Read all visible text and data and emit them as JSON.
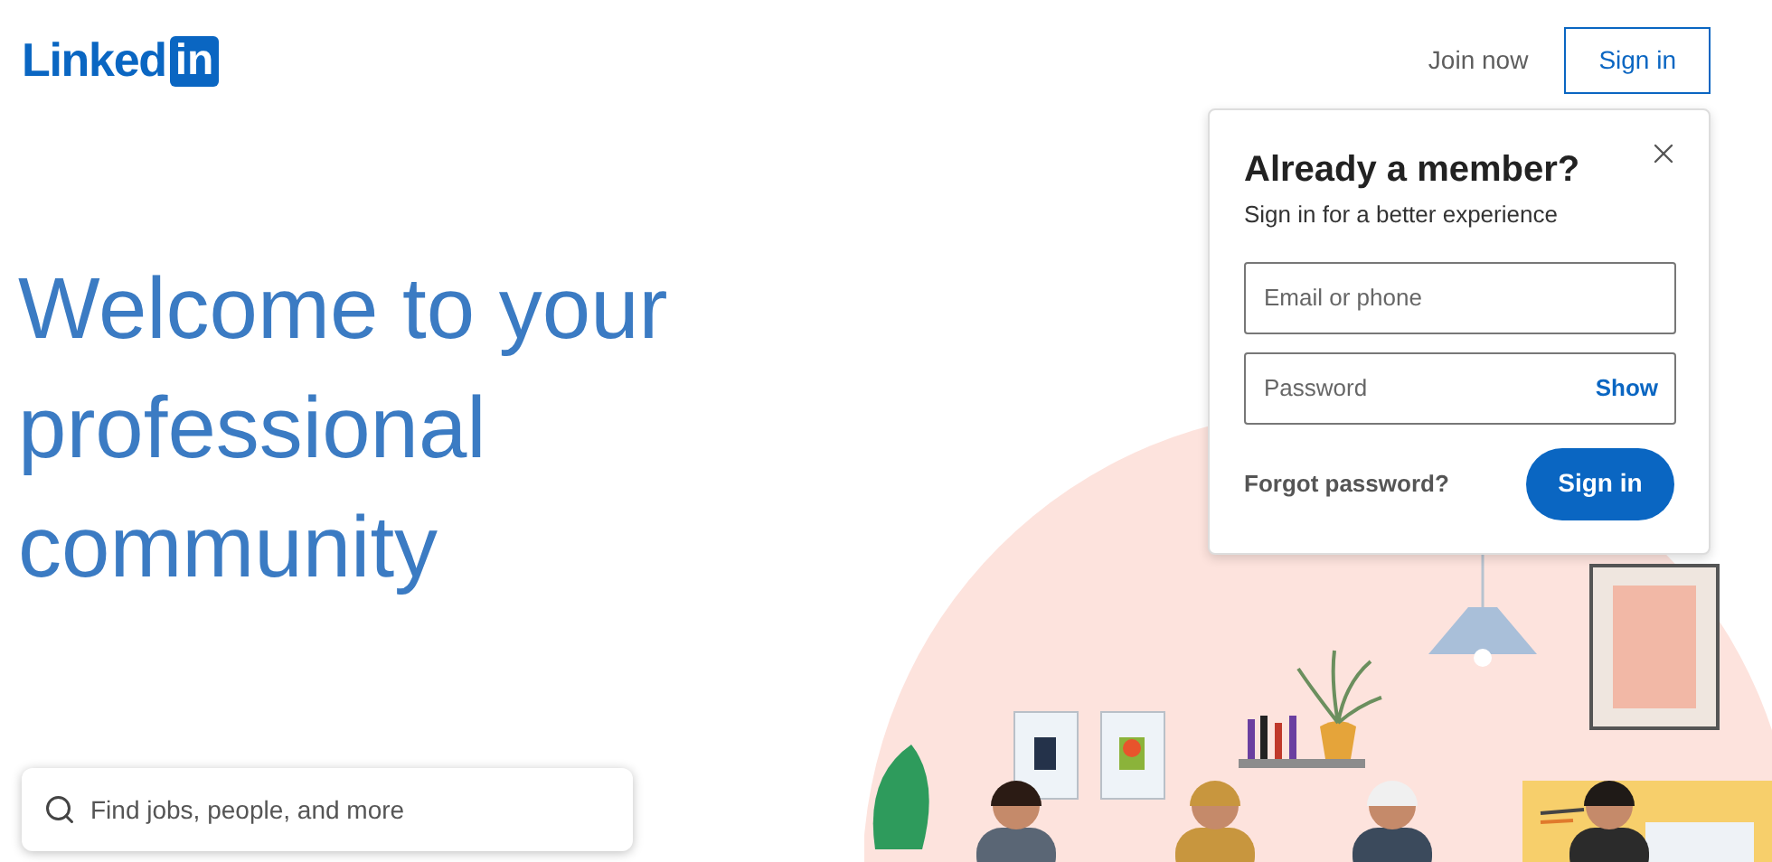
{
  "logo": {
    "text": "Linked",
    "badge": "in"
  },
  "nav": {
    "join": "Join now",
    "sign_in": "Sign in"
  },
  "hero": {
    "title": "Welcome to your professional community"
  },
  "search": {
    "placeholder": "Find jobs, people, and more"
  },
  "popup": {
    "title": "Already a member?",
    "subtitle": "Sign in for a better experience",
    "email_placeholder": "Email or phone",
    "password_placeholder": "Password",
    "show": "Show",
    "forgot": "Forgot password?",
    "submit": "Sign in"
  }
}
